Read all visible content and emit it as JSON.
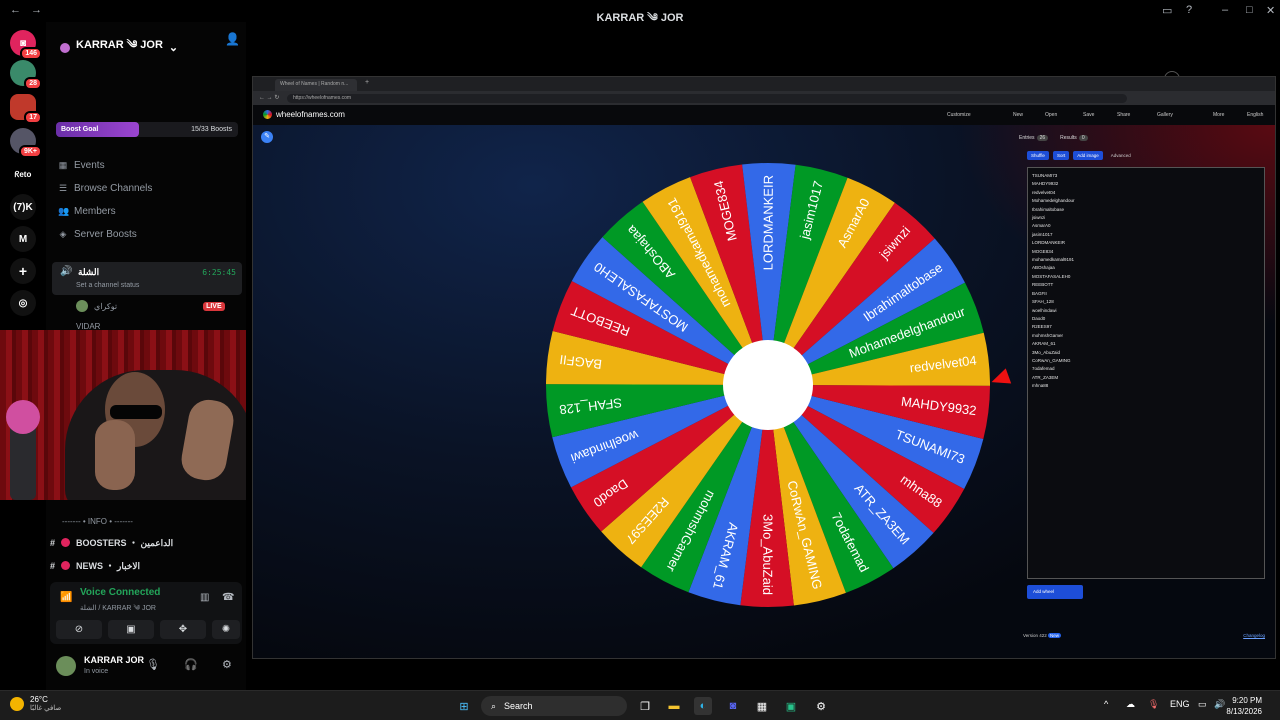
{
  "window": {
    "title": "KARRAR ༄ JOR"
  },
  "rail": {
    "servers": [
      {
        "label": "",
        "badge": "146",
        "color": "#e0245e"
      },
      {
        "label": "",
        "badge": "28",
        "color": "#3a8a6a"
      },
      {
        "label": "",
        "badge": "17",
        "color": "#c0392b"
      },
      {
        "label": "",
        "badge": "9K+",
        "color": "#556"
      },
      {
        "label": "ᖇeto",
        "badge": "",
        "color": "#000"
      },
      {
        "label": "(7)K",
        "badge": "",
        "color": "#111"
      },
      {
        "label": "M",
        "badge": "",
        "color": "#111"
      }
    ]
  },
  "sidebar": {
    "guild_name": "KARRAR ༄ JOR",
    "boost_goal": {
      "label": "Boost Goal",
      "count": "15/33 Boosts",
      "progress": 0.4545
    },
    "nav": [
      "Events",
      "Browse Channels",
      "Members",
      "Server Boosts"
    ],
    "voice_channel": {
      "name": "الشلة",
      "time": "6:25:45",
      "status": "Set a channel status"
    },
    "members": [
      {
        "name": "توكراي",
        "live": "LIVE"
      },
      {
        "name": "VIDAR",
        "live": ""
      }
    ],
    "category": "------- • INFO • -------",
    "channels": [
      {
        "name": "BOOSTERS ・ الداعمين"
      },
      {
        "name": "NEWS ・ الاخبار"
      }
    ]
  },
  "voice": {
    "status": "Voice Connected",
    "sub": "الشلة / KARRAR ༄ JOR"
  },
  "user": {
    "name": "KARRAR JOR",
    "status": "In voice"
  },
  "browser": {
    "tab_title": "Wheel of Names | Random n...",
    "url": "https://wheelofnames.com",
    "site_name": "wheelofnames.com",
    "menu": [
      "Customize",
      "New",
      "Open",
      "Save",
      "Share",
      "Gallery",
      "More",
      "English"
    ],
    "panel_tabs": [
      {
        "label": "Entries",
        "count": "26"
      },
      {
        "label": "Results",
        "count": "0"
      }
    ],
    "panel_buttons": [
      "Shuffle",
      "Sort",
      "Add image",
      "Advanced"
    ],
    "entries": [
      "TSUNAMI73",
      "MAHDY9932",
      "redvelvet04",
      "Mohamedelghandour",
      "Ibrahimaltobase",
      "jsiwnzi",
      "AsmarA0",
      "jasim1017",
      "LORDMANKEIR",
      "MOGE834",
      "mohamedkamal9191",
      "ABOshajaa",
      "MOSTAFASALEH0",
      "REEBOTT",
      "BAGFII",
      "SFAH_128",
      "woelhindawi",
      "Daod0",
      "R2EES97",
      "mohmshGamer",
      "AKRAM_61",
      "3Mo_AbuZaid",
      "CoRwAn_GAMING",
      "7odafemad",
      "ATR_ZA3EM",
      "mhna88"
    ],
    "add_wheel": "Add wheel",
    "version": "Version 422",
    "version_badge": "New",
    "changelog": "Changelog"
  },
  "wheel": {
    "segments": [
      "TSUNAMI73",
      "mhna88",
      "ATR_ZA3EM",
      "7odafemad",
      "CoRwAn_GAMING",
      "3Mo_AbuZaid",
      "AKRAM_61",
      "mohmshGamer",
      "R2EES97",
      "Daod0",
      "woelhindawi",
      "SFAH_128",
      "BAGFII",
      "REEBOTT",
      "MOSTAFASALEH0",
      "ABOshajaa",
      "mohamedkamal9191",
      "MOGE834",
      "LORDMANKEIR",
      "jasim1017",
      "AsmarA0",
      "jsiwnzi",
      "Ibrahimaltobase",
      "Mohamedelghandour",
      "redvelvet04",
      "MAHDY9932"
    ],
    "colors": [
      "#3369e8",
      "#d50f25",
      "#3369e8",
      "#009925",
      "#eeb211",
      "#d50f25",
      "#3369e8",
      "#009925",
      "#eeb211",
      "#d50f25",
      "#3369e8",
      "#009925",
      "#eeb211",
      "#d50f25",
      "#3369e8",
      "#009925",
      "#eeb211",
      "#d50f25",
      "#3369e8",
      "#009925",
      "#eeb211",
      "#d50f25",
      "#3369e8",
      "#009925",
      "#eeb211",
      "#d50f25"
    ]
  },
  "taskbar": {
    "weather_temp": "26°C",
    "weather_desc": "صافي غالبًا",
    "search": "Search",
    "lang": "ENG",
    "time": "9:20 PM",
    "date": "8/13/2026"
  }
}
